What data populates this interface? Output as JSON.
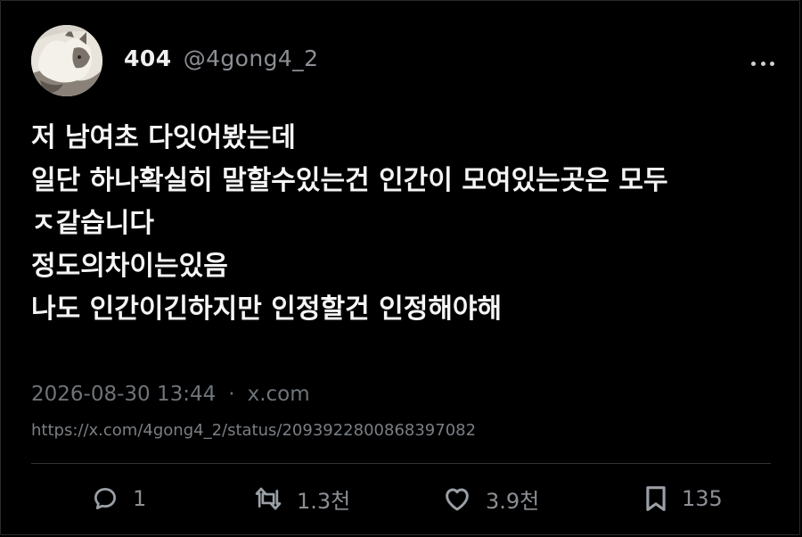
{
  "author": {
    "display_name": "404",
    "handle": "@4gong4_2"
  },
  "tweet": {
    "lines": [
      "저 남여초 다잇어봤는데",
      "일단 하나확실히 말할수있는건 인간이 모여있는곳은 모두",
      "ㅈ같습니다",
      "정도의차이는있음",
      "나도 인간이긴하지만 인정할건 인정해야해"
    ]
  },
  "meta": {
    "timestamp": "2026-08-30 13:44",
    "separator": "·",
    "source": "x.com",
    "status_url": "https://x.com/4gong4_2/status/2093922800868397082"
  },
  "actions": {
    "reply_count": "1",
    "retweet_count": "1.3천",
    "like_count": "3.9천",
    "bookmark_count": "135"
  },
  "icons": {
    "more": "more-horizontal-icon",
    "reply": "reply-icon",
    "retweet": "retweet-icon",
    "like": "heart-icon",
    "bookmark": "bookmark-icon"
  },
  "colors": {
    "background": "#000000",
    "text_primary": "#f5f5f5",
    "text_secondary": "#8b8f94",
    "divider": "#2f3336"
  }
}
